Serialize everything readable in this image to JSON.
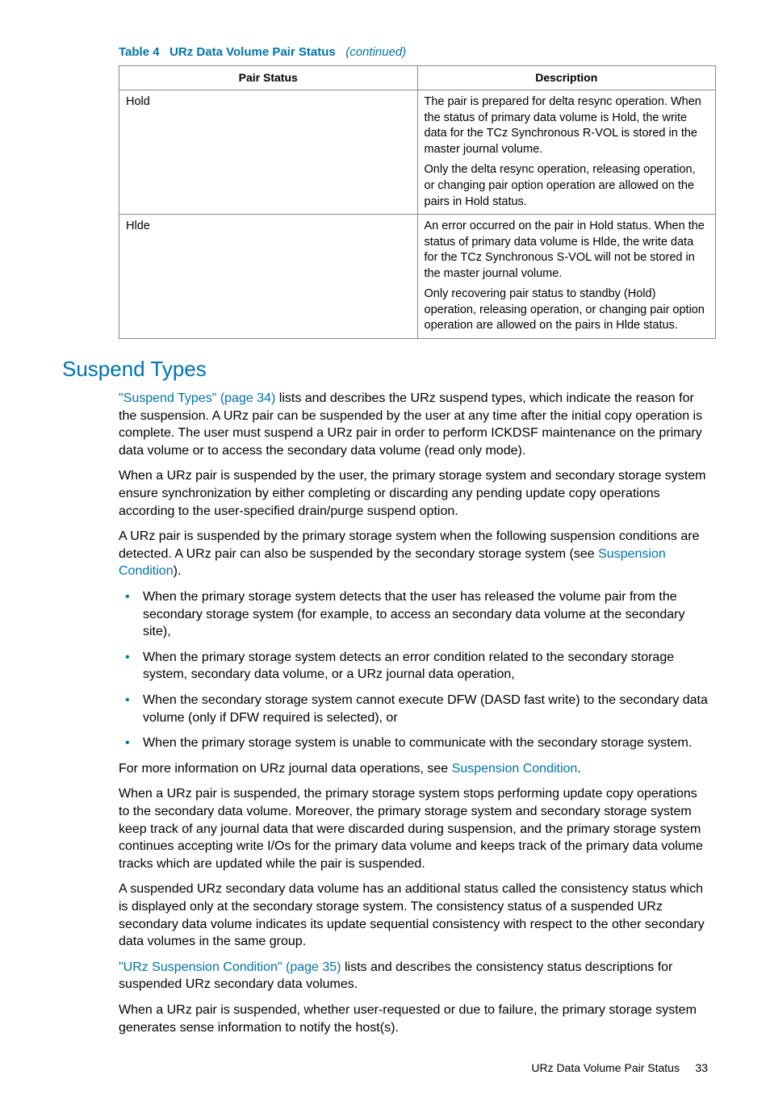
{
  "table": {
    "caption_prefix": "Table 4",
    "caption_title": "URz Data Volume Pair Status",
    "caption_suffix": "(continued)",
    "headers": [
      "Pair Status",
      "Description"
    ],
    "rows": [
      {
        "status": "Hold",
        "desc1": "The pair is prepared for delta resync operation. When the status of primary data volume is Hold, the write data for the TCz Synchronous R-VOL is stored in the master journal volume.",
        "desc2": "Only the delta resync operation, releasing operation, or changing pair option operation are allowed on the pairs in Hold status."
      },
      {
        "status": "Hlde",
        "desc1": "An error occurred on the pair in Hold status. When the status of primary data volume is Hlde, the write data for the TCz Synchronous S-VOL will not be stored in the master journal volume.",
        "desc2": "Only recovering pair status to standby (Hold) operation, releasing operation, or changing pair option operation are allowed on the pairs in Hlde status."
      }
    ]
  },
  "section": {
    "heading": "Suspend Types",
    "p1_link": "\"Suspend Types\" (page 34)",
    "p1_rest": " lists and describes the URz suspend types, which indicate the reason for the suspension. A URz pair can be suspended by the user at any time after the initial copy operation is complete. The user must suspend a URz pair in order to perform ICKDSF maintenance on the primary data volume or to access the secondary data volume (read only mode).",
    "p2": "When a URz pair is suspended by the user, the primary storage system and secondary storage system ensure synchronization by either completing or discarding any pending update copy operations according to the user-specified drain/purge suspend option.",
    "p3_a": "A URz pair is suspended by the primary storage system when the following suspension conditions are detected. A URz pair can also be suspended by the secondary storage system (see ",
    "p3_link": "Suspension Condition",
    "p3_b": ").",
    "bullets": [
      "When the primary storage system detects that the user has released the volume pair from the secondary storage system (for example, to access an secondary data volume at the secondary site),",
      "When the primary storage system detects an error condition related to the secondary storage system, secondary data volume, or a URz journal data operation,",
      "When the secondary storage system cannot execute DFW (DASD fast write) to the secondary data volume (only if DFW required is selected), or",
      "When the primary storage system is unable to communicate with the secondary storage system."
    ],
    "p4_a": "For more information on URz journal data operations, see ",
    "p4_link": "Suspension Condition",
    "p4_b": ".",
    "p5": "When a URz pair is suspended, the primary storage system stops performing update copy operations to the secondary data volume. Moreover, the primary storage system and secondary storage system keep track of any journal data that were discarded during suspension, and the primary storage system continues accepting write I/Os for the primary data volume and keeps track of the primary data volume tracks which are updated while the pair is suspended.",
    "p6": "A suspended URz secondary data volume has an additional status called the consistency status which is displayed only at the secondary storage system. The consistency status of a suspended URz secondary data volume indicates its update sequential consistency with respect to the other secondary data volumes in the same group.",
    "p7_link": "\"URz Suspension Condition\" (page 35)",
    "p7_rest": " lists and describes the consistency status descriptions for suspended URz secondary data volumes.",
    "p8": "When a URz pair is suspended, whether user-requested or due to failure, the primary storage system generates sense information to notify the host(s)."
  },
  "footer": {
    "label": "URz Data Volume Pair Status",
    "page": "33"
  }
}
